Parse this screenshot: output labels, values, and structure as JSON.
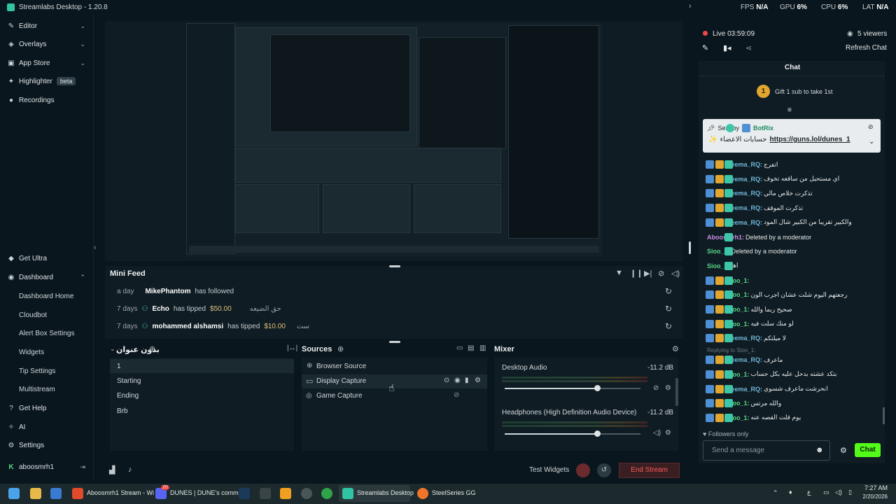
{
  "app": {
    "title": "Streamlabs Desktop - 1.20.8"
  },
  "stats": {
    "fps_label": "FPS",
    "fps_value": "N/A",
    "gpu_label": "GPU",
    "gpu_value": "6%",
    "cpu_label": "CPU",
    "cpu_value": "6%",
    "lat_label": "LAT",
    "lat_value": "N/A"
  },
  "sidebar": {
    "top": [
      {
        "label": "Editor",
        "icon": "editor-icon"
      },
      {
        "label": "Overlays",
        "icon": "overlays-icon"
      },
      {
        "label": "App Store",
        "icon": "store-icon"
      },
      {
        "label": "Highlighter",
        "icon": "highlighter-icon",
        "badge": "beta"
      },
      {
        "label": "Recordings",
        "icon": "recordings-icon"
      }
    ],
    "get_ultra": "Get Ultra",
    "dashboard": "Dashboard",
    "dashboard_items": [
      "Dashboard Home",
      "Cloudbot",
      "Alert Box Settings",
      "Widgets",
      "Tip Settings",
      "Multistream"
    ],
    "get_help": "Get Help",
    "ai": "AI",
    "settings": "Settings",
    "user": "aboosmrh1"
  },
  "mini_feed": {
    "title": "Mini Feed",
    "rows": [
      {
        "time": "a day",
        "name": "MikePhantom",
        "action": "has followed",
        "amount": "",
        "message": ""
      },
      {
        "time": "7 days",
        "name": "Echo",
        "action": "has tipped",
        "amount": "$50.00",
        "message": "حق الضيعه"
      },
      {
        "time": "7 days",
        "name": "mohammed alshamsi",
        "action": "has tipped",
        "amount": "$10.00",
        "message": "ست"
      }
    ]
  },
  "scenes": {
    "title": "بدون عنوان",
    "items": [
      "1",
      "Starting",
      "Ending",
      "Brb"
    ]
  },
  "sources": {
    "title": "Sources",
    "items": [
      "Browser Source",
      "Display Capture",
      "Game Capture"
    ]
  },
  "mixer": {
    "title": "Mixer",
    "channels": [
      {
        "name": "Desktop Audio",
        "db": "-11.2 dB",
        "level": 0.68
      },
      {
        "name": "Headphones (High Definition Audio Device)",
        "db": "-11.2 dB",
        "level": 0.68
      }
    ]
  },
  "bottom": {
    "test_widgets": "Test Widgets",
    "end_stream": "End Stream"
  },
  "stream": {
    "live": "Live 03:59:09",
    "viewers": "5 viewers",
    "refresh_chat": "Refresh Chat"
  },
  "chat": {
    "title": "Chat",
    "gift_count": "1",
    "gift_text": "Gift 1 sub to take 1st",
    "pinned_by": "Sent by",
    "pinned_user": "BotRix",
    "pinned_text": "حسابات الاعضاء",
    "pinned_link": "https://guns.lol/dunes_1",
    "messages": [
      {
        "user": "Reema_RQ:",
        "text": "اتفرج",
        "kind": "reema"
      },
      {
        "user": "Reema_RQ:",
        "text": "اي مستحيل من ساقعه تخوف",
        "kind": "reema"
      },
      {
        "user": "Reema_RQ:",
        "text": "تذكرت خلاص مالي",
        "kind": "reema"
      },
      {
        "user": "Reema_RQ:",
        "text": "تذكرت الموقف",
        "kind": "reema"
      },
      {
        "user": "Reema_RQ:",
        "text": "والكبير تقريبا من الكبير شال المود",
        "kind": "reema"
      },
      {
        "user": "Aboosmrh1:",
        "text": "Deleted by a moderator",
        "kind": "aboos"
      },
      {
        "user": "Sioo_1:",
        "text": "Deleted by a moderator",
        "kind": "sioo"
      },
      {
        "user": "Sioo_1:",
        "text": "اها",
        "kind": "sioo"
      },
      {
        "user": "Sioo_1:",
        "text": "",
        "kind": "sioo"
      },
      {
        "user": "Sioo_1:",
        "text": "رجعتهم اليوم شلت عشان اجرب الون",
        "kind": "sioo"
      },
      {
        "user": "Sioo_1:",
        "text": "صحيح ربما والله",
        "kind": "sioo"
      },
      {
        "user": "Sioo_1:",
        "text": "لو منك سلت فيه",
        "kind": "sioo"
      },
      {
        "user": "Reema_RQ:",
        "text": "لا ميلتكم",
        "kind": "reema"
      },
      {
        "user": "Reema_RQ:",
        "text": "ماعرف",
        "kind": "reema"
      },
      {
        "user": "Sioo_1:",
        "text": "بتكد عشته بدحل عليه بكل حساب",
        "kind": "sioo"
      },
      {
        "user": "Reema_RQ:",
        "text": "انحرشت ماعرف شسوي",
        "kind": "reema"
      },
      {
        "user": "Sioo_1:",
        "text": "والله مرتس",
        "kind": "sioo"
      },
      {
        "user": "Sioo_1:",
        "text": "يوم قلت القصه عنه",
        "kind": "sioo"
      }
    ],
    "reply_hint": "Replying to Sioo_1:",
    "followers_only": "Followers only",
    "input_placeholder": "Send a message",
    "send_label": "Chat"
  },
  "taskbar": {
    "apps": [
      {
        "label": "Aboosmrh1 Stream - Wi"
      },
      {
        "label": "DUNES | DUNE's comm"
      },
      {
        "label": "Streamlabs Desktop"
      },
      {
        "label": "SteelSeries GG"
      }
    ],
    "badge": "20",
    "time": "7:27 AM",
    "date": "2/20/2026",
    "lang": "ع"
  },
  "colors": {
    "accent": "#31c3a2",
    "live": "#f04a4a",
    "gold": "#e1c07c"
  }
}
